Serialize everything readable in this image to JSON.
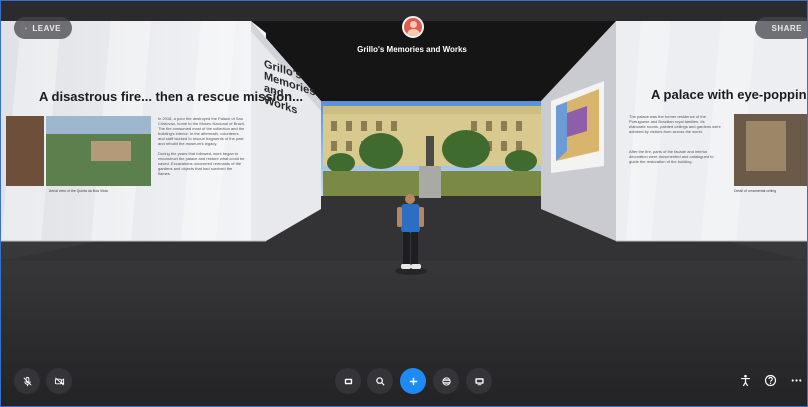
{
  "header": {
    "leave_label": "LEAVE",
    "share_label": "SHARE",
    "room_title": "Grillo's Memories and Works"
  },
  "walls": {
    "left": {
      "heading": "A disastrous fire... then a rescue mission...",
      "paragraph": "In 2018, a poor fire destroyed the Palace of Sao Cristovao, home to the Museu Nacional of Brazil. The fire consumed most of the collection and the building's interior. In the aftermath, volunteers and staff worked to rescue fragments of the past and rebuild the museum's legacy.",
      "paragraph_2": "During the years that followed, work began to reconstruct the palace and restore what could be saved. Excavations uncovered remnants of the gardens and objects that had survived the flames.",
      "caption": "Aerial view of the Quinta da Boa Vista"
    },
    "center": {
      "title": "Grillo's Memories and Works"
    },
    "right": {
      "heading": "A palace with eye-popping detail",
      "paragraph": "The palace was the former residence of the Portuguese and Brazilian royal families. Its elaborate rooms, painted ceilings and gardens were admired by visitors from across the world.",
      "paragraph_2": "After the fire, parts of the facade and interior decoration were documented and catalogued to guide the restoration of the building.",
      "caption": "Detail of ornamental ceiling"
    }
  },
  "toolbar": {
    "left": [
      {
        "name": "mic-muted-icon"
      },
      {
        "name": "camera-off-icon"
      }
    ],
    "center": [
      {
        "name": "frame-icon"
      },
      {
        "name": "search-icon"
      },
      {
        "name": "plus-icon"
      },
      {
        "name": "stack-icon"
      },
      {
        "name": "screen-share-icon"
      }
    ],
    "right": [
      {
        "name": "accessibility-icon"
      },
      {
        "name": "help-icon"
      },
      {
        "name": "more-icon"
      }
    ]
  },
  "colors": {
    "accent": "#1e8bf5",
    "floor": "#2e2e30",
    "wall": "#e7e8ec",
    "frame_border": "#3b6fc9"
  }
}
